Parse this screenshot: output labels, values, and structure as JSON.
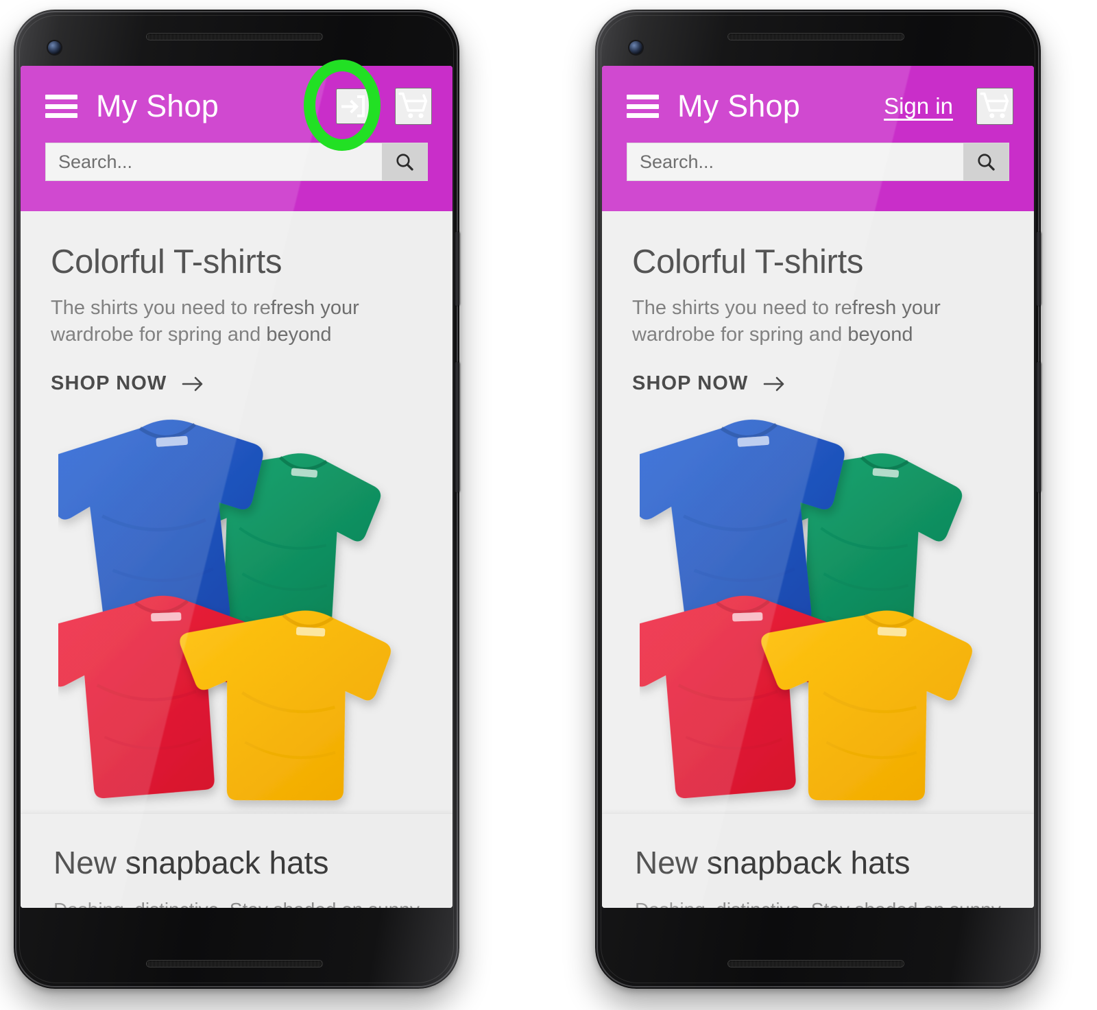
{
  "figure": {
    "type": "mobile-ui-comparison",
    "panels": [
      "icon-variant",
      "text-variant"
    ]
  },
  "colors": {
    "appbar_magenta": "#C92EC9",
    "highlight_green": "#22E024",
    "screen_background": "#EEEEEE",
    "search_field": "#F2F2F2",
    "search_button": "#D2D2D2",
    "shirt_blue": "#1C56C4",
    "shirt_green": "#149A68",
    "shirt_red": "#ED1C35",
    "shirt_yellow": "#FBBA04"
  },
  "app": {
    "brand": "My Shop",
    "menu_icon": "hamburger-menu-icon",
    "cart_icon": "shopping-cart-icon",
    "search": {
      "placeholder": "Search...",
      "value": "",
      "button_icon": "search-icon"
    },
    "hero_card": {
      "title": "Colorful T-shirts",
      "subtitle": "The shirts you need to refresh your wardrobe for spring and beyond",
      "cta_label": "SHOP NOW",
      "cta_icon": "arrow-right-icon",
      "image_alt": "four folded t-shirts"
    },
    "second_card": {
      "title": "New snapback hats",
      "subtitle": "Dashing, distinctive. Stay shaded on sunny"
    }
  },
  "panels": {
    "left": {
      "name": "icon-variant",
      "signin_icon": "login-icon",
      "signin_label": "",
      "highlight_target": "sign-in-icon-button"
    },
    "right": {
      "name": "text-variant",
      "signin_icon": "",
      "signin_label": "Sign in",
      "highlight_target": "sign-in-text-link"
    }
  }
}
